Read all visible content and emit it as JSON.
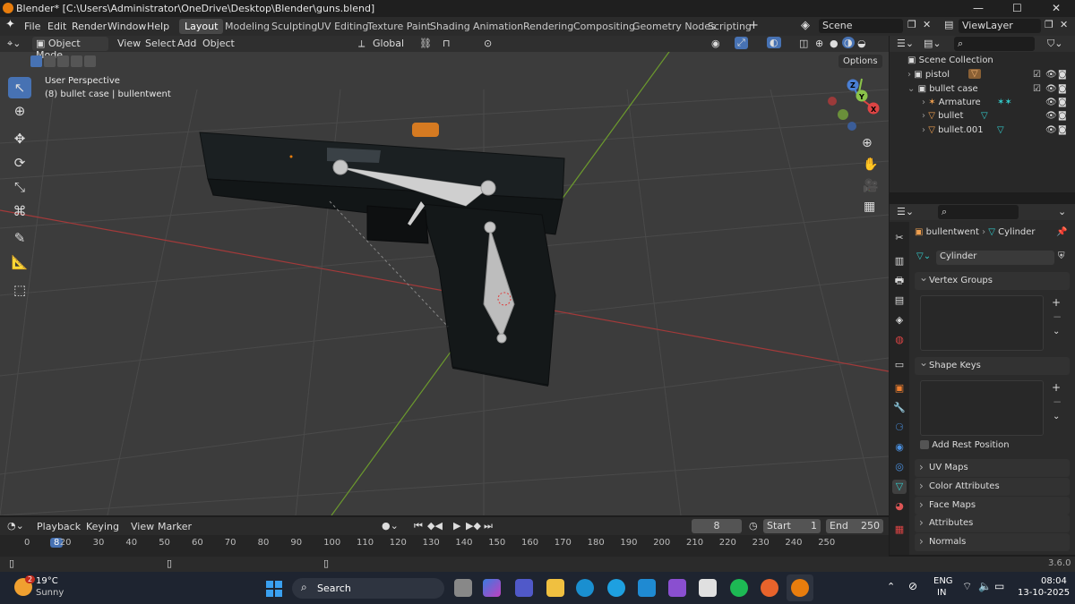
{
  "window": {
    "title": "Blender* [C:\\Users\\Administrator\\OneDrive\\Desktop\\Blender\\guns.blend]",
    "minimize": "—",
    "maximize": "☐",
    "close": "✕"
  },
  "menu": {
    "items": [
      "File",
      "Edit",
      "Render",
      "Window",
      "Help"
    ]
  },
  "workspaces": [
    "Layout",
    "Modeling",
    "Sculpting",
    "UV Editing",
    "Texture Paint",
    "Shading",
    "Animation",
    "Rendering",
    "Compositing",
    "Geometry Nodes",
    "Scripting"
  ],
  "workspace_add": "+",
  "scene": {
    "name": "Scene",
    "view_layer": "ViewLayer"
  },
  "viewport_header": {
    "mode": "Object Mode",
    "menus": [
      "View",
      "Select",
      "Add",
      "Object"
    ],
    "transform": "Global",
    "options_label": "Options"
  },
  "viewport": {
    "perspective_label": "User Perspective",
    "object_info": "(8) bullet case | bullentwent",
    "gizmo": {
      "x": "X",
      "y": "Y",
      "z": "Z"
    }
  },
  "outliner": {
    "root": "Scene Collection",
    "items": [
      {
        "name": "pistol"
      },
      {
        "name": "bullet case"
      },
      {
        "name": "Armature"
      },
      {
        "name": "bullet"
      },
      {
        "name": "bullet.001"
      }
    ]
  },
  "properties": {
    "breadcrumb_object": "bullentwent",
    "breadcrumb_mesh": "Cylinder",
    "mesh_name": "Cylinder",
    "panels": {
      "vertex_groups": "Vertex Groups",
      "shape_keys": "Shape Keys",
      "add_rest_position": "Add Rest Position",
      "uv_maps": "UV Maps",
      "color_attributes": "Color Attributes",
      "face_maps": "Face Maps",
      "attributes": "Attributes",
      "normals": "Normals"
    },
    "add_btn": "+",
    "remove_btn": "−",
    "menu_btn": "⌄"
  },
  "timeline": {
    "menus": [
      "Playback",
      "Keying",
      "View",
      "Marker"
    ],
    "current_frame": "8",
    "start_label": "Start",
    "start": "1",
    "end_label": "End",
    "end": "250",
    "ruler": [
      "0",
      "8",
      "20",
      "30",
      "40",
      "50",
      "60",
      "70",
      "80",
      "90",
      "100",
      "110",
      "120",
      "130",
      "140",
      "150",
      "160",
      "170",
      "180",
      "190",
      "200",
      "210",
      "220",
      "230",
      "240",
      "250"
    ]
  },
  "statusbar": {
    "version": "3.6.0"
  },
  "taskbar": {
    "weather_temp": "19°C",
    "weather_desc": "Sunny",
    "weather_badge": "2",
    "search": "Search",
    "lang": "ENG",
    "region": "IN",
    "time": "08:04",
    "date": "13-10-2025"
  },
  "colors": {
    "accent": "#4772b3",
    "orange": "#e87d0d",
    "bg": "#3c3c3c"
  }
}
